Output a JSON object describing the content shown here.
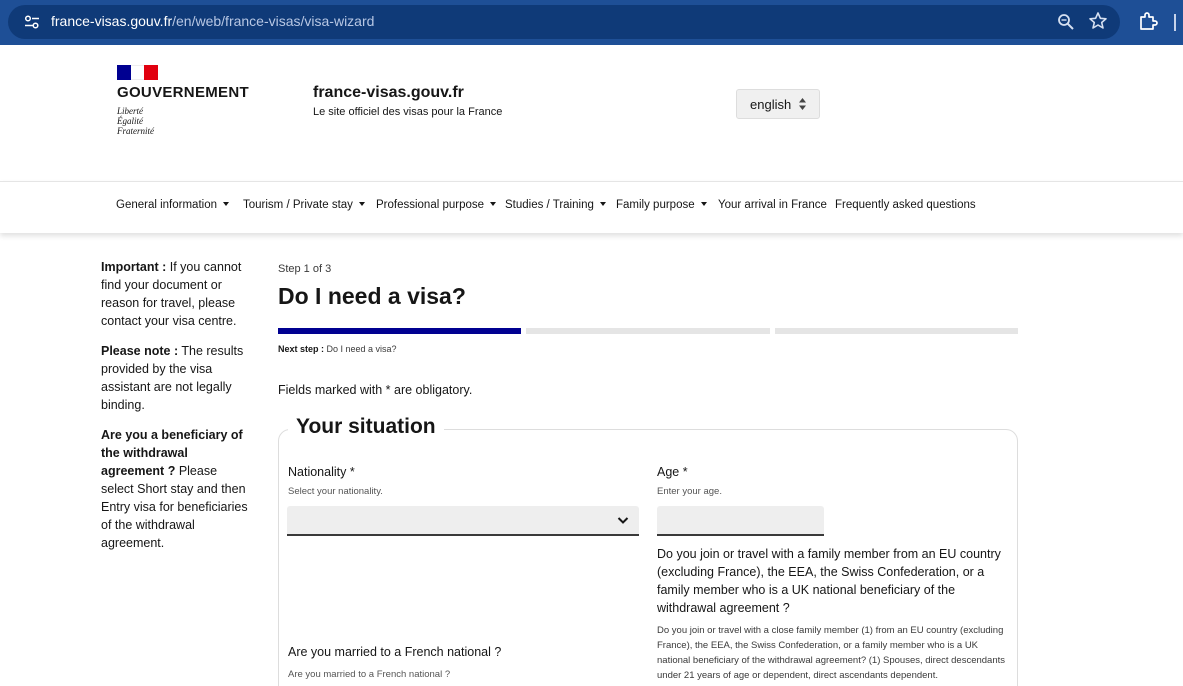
{
  "browser": {
    "url_host": "france-visas.gouv.fr",
    "url_path": "/en/web/france-visas/visa-wizard"
  },
  "header": {
    "gov_name": "GOUVERNEMENT",
    "motto": [
      "Liberté",
      "Égalité",
      "Fraternité"
    ],
    "site_title": "france-visas.gouv.fr",
    "site_tagline": "Le site officiel des visas pour la France",
    "language": "english"
  },
  "nav": {
    "items": [
      {
        "label": "General information"
      },
      {
        "label": "Tourism / Private stay"
      },
      {
        "label": "Professional purpose"
      },
      {
        "label": "Studies / Training"
      },
      {
        "label": "Family purpose"
      },
      {
        "label": "Your arrival in France"
      },
      {
        "label": "Frequently asked questions"
      }
    ]
  },
  "sidebar": {
    "important_label": "Important :",
    "important_text": " If you cannot find your document or reason for travel, please contact your visa centre.",
    "note_label": "Please note :",
    "note_text": " The results provided by the visa assistant are not legally binding.",
    "beneficiary_label": "Are you a beneficiary of the withdrawal agreement ?",
    "beneficiary_text": " Please select Short stay and then Entry visa for beneficiaries of the withdrawal agreement."
  },
  "main": {
    "step_label": "Step 1 of 3",
    "title": "Do I need a visa?",
    "next_step_label": "Next step :",
    "next_step_value": " Do I need a visa?",
    "obligatory_note": "Fields marked with * are obligatory.",
    "steps_completed": 1,
    "steps_total": 3,
    "progress_color": "#000091",
    "situation": {
      "legend": "Your situation",
      "nationality_label": "Nationality *",
      "nationality_hint": "Select your nationality.",
      "nationality_value": "",
      "age_label": "Age *",
      "age_hint": "Enter your age.",
      "age_value": "",
      "family_question": "Do you join or travel with a family member from an EU country (excluding France), the EEA, the Swiss Confederation, or a family member who is a UK national beneficiary of the withdrawal agreement ?",
      "family_hint": "Do you join or travel with a close family member (1) from an EU country (excluding France), the EEA, the Swiss Confederation, or a family member who is a UK national beneficiary of the withdrawal agreement? (1) Spouses, direct descendants under 21 years of age or dependent, direct ascendants dependent.",
      "married_label": "Are you married to a French national ?",
      "married_hint": "Are you married to a French national ?"
    }
  },
  "icons": {
    "site_info": "tune-icon",
    "zoom": "zoom-icon",
    "bookmark": "star-icon",
    "extensions": "extension-icon",
    "language_arrows": "updown-arrows-icon",
    "dropdown": "chevron-down-icon"
  }
}
